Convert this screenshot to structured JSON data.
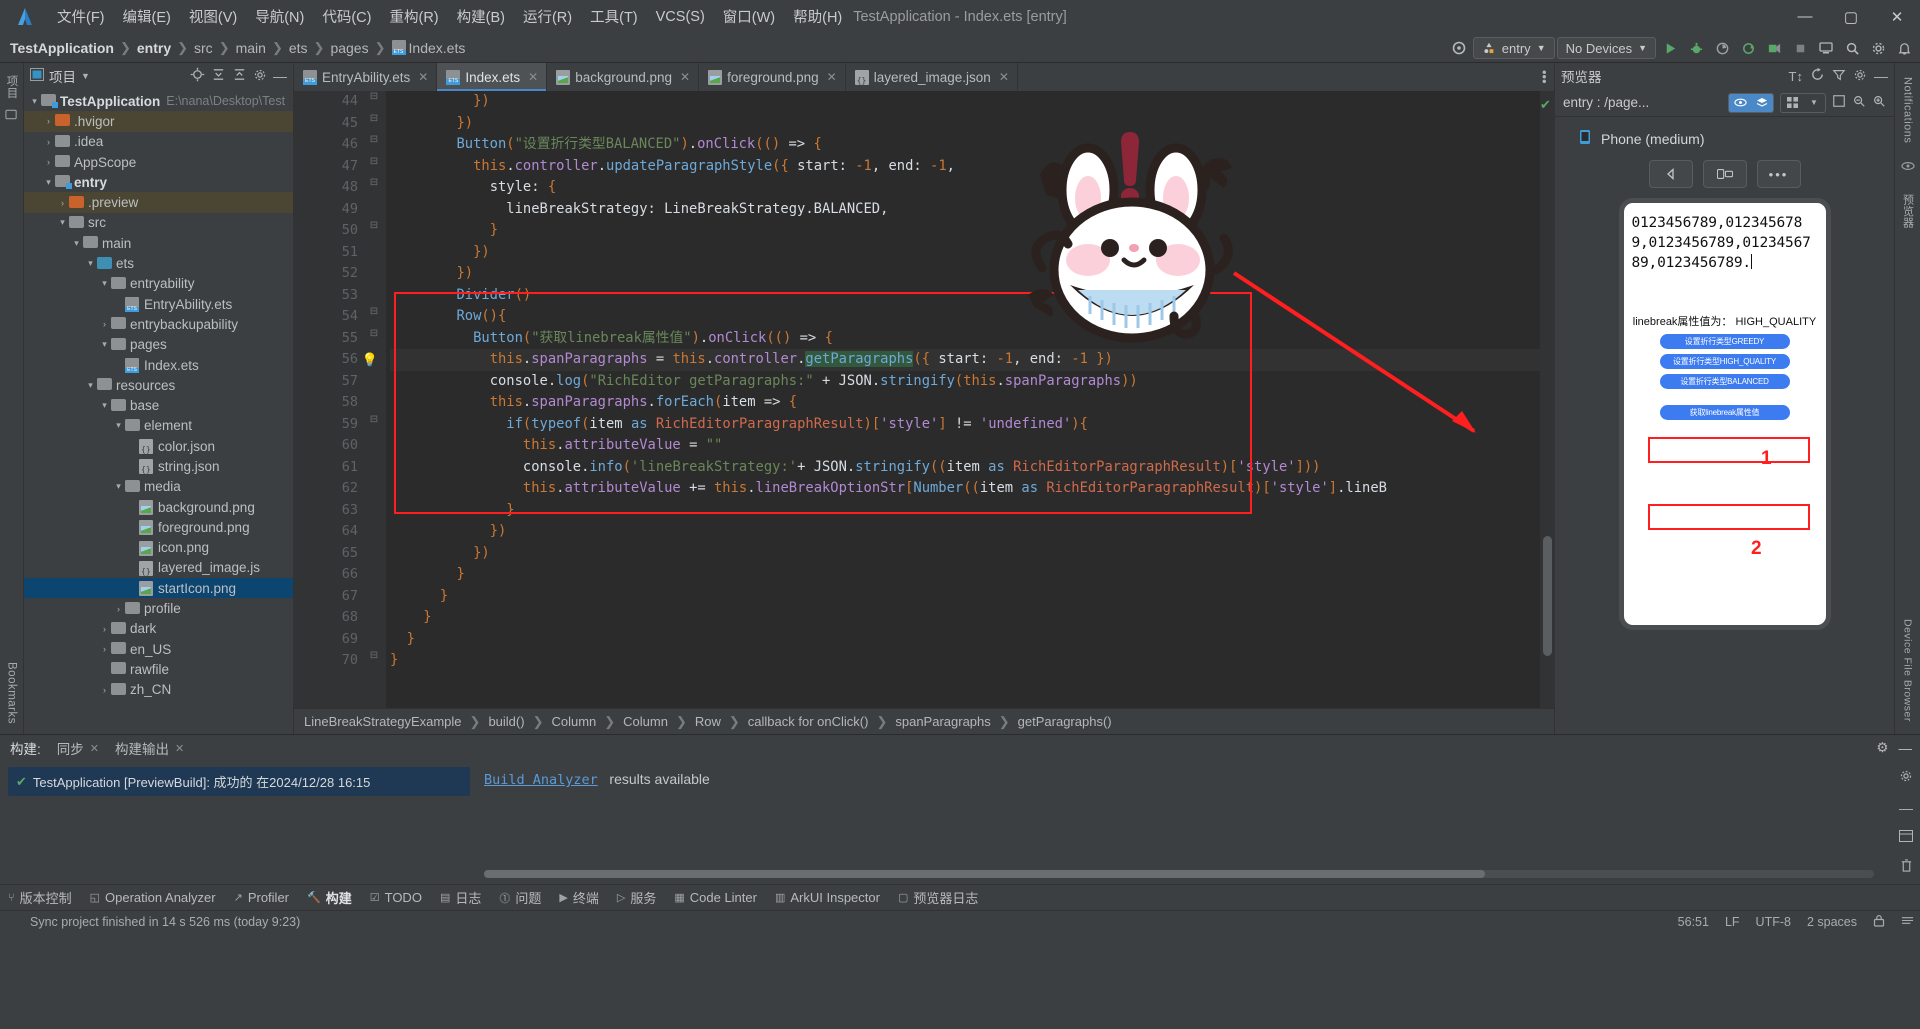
{
  "window": {
    "title": "TestApplication - Index.ets [entry]",
    "minimize": "—",
    "maximize": "▢",
    "close": "✕"
  },
  "menu": [
    "文件(F)",
    "编辑(E)",
    "视图(V)",
    "导航(N)",
    "代码(C)",
    "重构(R)",
    "构建(B)",
    "运行(R)",
    "工具(T)",
    "VCS(S)",
    "窗口(W)",
    "帮助(H)"
  ],
  "breadcrumb": [
    "TestApplication",
    "entry",
    "src",
    "main",
    "ets",
    "pages",
    "Index.ets"
  ],
  "toolbar": {
    "run_config": "entry",
    "device": "No Devices",
    "target_icon": "target-icon",
    "run_icon": "run-icon",
    "debug_icon": "debug-icon",
    "profile_icon": "profile-icon",
    "sync_icon": "sync-icon",
    "attach_icon": "attach-icon",
    "stop_icon": "stop-icon",
    "device_manager_icon": "device-manager-icon",
    "search_icon": "search-icon",
    "settings_icon": "gear-icon",
    "notifications_icon": "bell-icon"
  },
  "project_panel": {
    "title": "项目",
    "dropdown_icon": "chevron-down-icon",
    "locate_icon": "locate-icon",
    "expand_icon": "expand-all-icon",
    "collapse_icon": "collapse-all-icon",
    "settings_icon": "gear-icon",
    "hide_icon": "hide-icon",
    "tree": [
      {
        "depth": 0,
        "arrow": "▾",
        "icon": "module-folder",
        "name": "TestApplication",
        "bold": true,
        "path": "E:\\nana\\Desktop\\Test",
        "state": "normal"
      },
      {
        "depth": 1,
        "arrow": "›",
        "icon": "orange-folder",
        "name": ".hvigor",
        "state": "highlight"
      },
      {
        "depth": 1,
        "arrow": "›",
        "icon": "folder",
        "name": ".idea",
        "state": "normal"
      },
      {
        "depth": 1,
        "arrow": "›",
        "icon": "folder",
        "name": "AppScope",
        "state": "normal"
      },
      {
        "depth": 1,
        "arrow": "▾",
        "icon": "module-folder",
        "name": "entry",
        "bold": true,
        "state": "normal"
      },
      {
        "depth": 2,
        "arrow": "›",
        "icon": "orange-folder",
        "name": ".preview",
        "state": "highlight"
      },
      {
        "depth": 2,
        "arrow": "▾",
        "icon": "folder",
        "name": "src",
        "state": "normal"
      },
      {
        "depth": 3,
        "arrow": "▾",
        "icon": "folder",
        "name": "main",
        "state": "normal"
      },
      {
        "depth": 4,
        "arrow": "▾",
        "icon": "blue-folder",
        "name": "ets",
        "state": "normal"
      },
      {
        "depth": 5,
        "arrow": "▾",
        "icon": "folder",
        "name": "entryability",
        "state": "normal"
      },
      {
        "depth": 6,
        "arrow": "",
        "icon": "ets-file",
        "name": "EntryAbility.ets",
        "state": "normal"
      },
      {
        "depth": 5,
        "arrow": "›",
        "icon": "folder",
        "name": "entrybackupability",
        "state": "normal"
      },
      {
        "depth": 5,
        "arrow": "▾",
        "icon": "folder",
        "name": "pages",
        "state": "normal"
      },
      {
        "depth": 6,
        "arrow": "",
        "icon": "ets-file",
        "name": "Index.ets",
        "state": "normal"
      },
      {
        "depth": 4,
        "arrow": "▾",
        "icon": "folder",
        "name": "resources",
        "state": "normal"
      },
      {
        "depth": 5,
        "arrow": "▾",
        "icon": "folder",
        "name": "base",
        "state": "normal"
      },
      {
        "depth": 6,
        "arrow": "▾",
        "icon": "folder",
        "name": "element",
        "state": "normal"
      },
      {
        "depth": 7,
        "arrow": "",
        "icon": "json-file",
        "name": "color.json",
        "state": "normal"
      },
      {
        "depth": 7,
        "arrow": "",
        "icon": "json-file",
        "name": "string.json",
        "state": "normal"
      },
      {
        "depth": 6,
        "arrow": "▾",
        "icon": "folder",
        "name": "media",
        "state": "normal"
      },
      {
        "depth": 7,
        "arrow": "",
        "icon": "png-file",
        "name": "background.png",
        "state": "normal"
      },
      {
        "depth": 7,
        "arrow": "",
        "icon": "png-file",
        "name": "foreground.png",
        "state": "normal"
      },
      {
        "depth": 7,
        "arrow": "",
        "icon": "png-file",
        "name": "icon.png",
        "state": "normal"
      },
      {
        "depth": 7,
        "arrow": "",
        "icon": "json-file",
        "name": "layered_image.js",
        "state": "normal"
      },
      {
        "depth": 7,
        "arrow": "",
        "icon": "png-file",
        "name": "startIcon.png",
        "state": "selected"
      },
      {
        "depth": 6,
        "arrow": "›",
        "icon": "folder",
        "name": "profile",
        "state": "normal"
      },
      {
        "depth": 5,
        "arrow": "›",
        "icon": "folder",
        "name": "dark",
        "state": "normal"
      },
      {
        "depth": 5,
        "arrow": "›",
        "icon": "folder",
        "name": "en_US",
        "state": "normal"
      },
      {
        "depth": 5,
        "arrow": "",
        "icon": "folder",
        "name": "rawfile",
        "state": "normal"
      },
      {
        "depth": 5,
        "arrow": "›",
        "icon": "folder",
        "name": "zh_CN",
        "state": "normal"
      }
    ]
  },
  "left_strip": {
    "project_label": "项目",
    "structure_icon": "structure-icon",
    "bookmarks_label": "Bookmarks"
  },
  "right_strip": {
    "notifications_label": "Notifications",
    "preview_label": "预览器",
    "device_file_label": "Device File Browser"
  },
  "editor": {
    "tabs": [
      {
        "label": "EntryAbility.ets",
        "icon": "ets-file",
        "active": false
      },
      {
        "label": "Index.ets",
        "icon": "ets-file",
        "active": true
      },
      {
        "label": "background.png",
        "icon": "png-file",
        "active": false
      },
      {
        "label": "foreground.png",
        "icon": "png-file",
        "active": false
      },
      {
        "label": "layered_image.json",
        "icon": "json-file",
        "active": false
      }
    ],
    "more_icon": "more-vertical-icon",
    "first_line": 44,
    "lines": [
      {
        "n": 44,
        "fold": "⌐",
        "html": "          <span class='or'>})</span>"
      },
      {
        "n": 45,
        "fold": "⌐",
        "html": "        <span class='or'>})</span>"
      },
      {
        "n": 46,
        "fold": "⌐",
        "html": "        <span class='bl'>Button</span><span class='or'>(</span><span class='gr'>\"设置折行类型BALANCED\"</span><span class='or'>)</span><span class='wh'>.</span><span class='pp'>onClick</span><span class='or'>((</span><span class='or'>)</span> <span class='wh'>=&gt;</span> <span class='or'>{</span>"
      },
      {
        "n": 47,
        "fold": "⌐",
        "html": "          <span class='or'>this</span><span class='wh'>.</span><span class='pp'>controller</span><span class='wh'>.</span><span class='bl'>updateParagraphStyle</span><span class='or'>({</span> <span class='wh'>start:</span> <span class='or'>-1</span><span class='wh'>, end:</span> <span class='or'>-1</span><span class='wh'>,</span>"
      },
      {
        "n": 48,
        "fold": "⌐",
        "html": "            <span class='wh'>style:</span> <span class='or'>{</span>"
      },
      {
        "n": 49,
        "fold": "",
        "html": "              <span class='wh'>lineBreakStrategy: LineBreakStrategy.BALANCED,</span>"
      },
      {
        "n": 50,
        "fold": "⌐",
        "html": "            <span class='or'>}</span>"
      },
      {
        "n": 51,
        "fold": "",
        "html": "          <span class='or'>})</span>"
      },
      {
        "n": 52,
        "fold": "",
        "html": "        <span class='or'>})</span>"
      },
      {
        "n": 53,
        "fold": "",
        "html": "        <span class='bl'>Divider</span><span class='or'>()</span>"
      },
      {
        "n": 54,
        "fold": "⌐",
        "html": "        <span class='bl'>Row</span><span class='or'>(){</span>"
      },
      {
        "n": 55,
        "fold": "⌐",
        "html": "          <span class='bl'>Button</span><span class='or'>(</span><span class='gr'>\"获取linebreak属性值\"</span><span class='or'>)</span><span class='wh'>.</span><span class='pp'>onClick</span><span class='or'>((</span><span class='or'>)</span> <span class='wh'>=&gt;</span> <span class='or'>{</span>"
      },
      {
        "n": 56,
        "fold": "",
        "bulb": true,
        "cur": true,
        "html": "            <span class='or'>this</span><span class='wh'>.</span><span class='pp'>spanParagraphs</span> <span class='wh'>=</span> <span class='or'>this</span><span class='wh'>.</span><span class='pp'>controller</span><span class='wh'>.</span><span class='hlx bl'>getParagraphs</span><span class='or'>({</span> <span class='wh'>start:</span> <span class='or'>-1</span><span class='wh'>, end:</span> <span class='or'>-1</span> <span class='or'>})</span>"
      },
      {
        "n": 57,
        "fold": "",
        "html": "            <span class='wh'>console</span><span class='wh'>.</span><span class='bl'>log</span><span class='or'>(</span><span class='gr'>\"RichEditor getParagraphs:\"</span> <span class='wh'>+</span> <span class='wh'>JSON</span><span class='wh'>.</span><span class='bl'>stringify</span><span class='or'>(</span><span class='or'>this</span><span class='wh'>.</span><span class='pp'>spanParagraphs</span><span class='or'>))</span>"
      },
      {
        "n": 58,
        "fold": "",
        "html": "            <span class='or'>this</span><span class='wh'>.</span><span class='pp'>spanParagraphs</span><span class='wh'>.</span><span class='bl'>forEach</span><span class='or'>(</span><span class='wh'>item</span> <span class='wh'>=&gt;</span> <span class='or'>{</span>"
      },
      {
        "n": 59,
        "fold": "⌐",
        "html": "              <span class='bl'>if</span><span class='or'>(</span><span class='bl'>typeof</span><span class='or'>(</span><span class='wh'>item</span> <span class='bl'>as</span> <span class='red'>RichEditorParagraphResult</span><span class='or'>)[</span><span class='pp'>'style'</span><span class='or'>]</span> <span class='wh'>!=</span> <span class='pp'>'undefined'</span><span class='or'>){</span>"
      },
      {
        "n": 60,
        "fold": "",
        "html": "                <span class='or'>this</span><span class='wh'>.</span><span class='pp'>attributeValue</span> <span class='wh'>=</span> <span class='gr'>\"\"</span>"
      },
      {
        "n": 61,
        "fold": "",
        "html": "                <span class='wh'>console</span><span class='wh'>.</span><span class='bl'>info</span><span class='or'>(</span><span class='gr'>'lineBreakStrategy:'</span><span class='wh'>+</span> <span class='wh'>JSON</span><span class='wh'>.</span><span class='bl'>stringify</span><span class='or'>((</span><span class='wh'>item</span> <span class='bl'>as</span> <span class='red'>RichEditorParagraphResult</span><span class='or'>)[</span><span class='pp'>'style'</span><span class='or'>]))</span>"
      },
      {
        "n": 62,
        "fold": "",
        "html": "                <span class='or'>this</span><span class='wh'>.</span><span class='pp'>attributeValue</span> <span class='wh'>+=</span> <span class='or'>this</span><span class='wh'>.</span><span class='pp'>lineBreakOptionStr</span><span class='or'>[</span><span class='bl'>Number</span><span class='or'>((</span><span class='wh'>item</span> <span class='bl'>as</span> <span class='red'>RichEditorParagraphResult</span><span class='or'>)[</span><span class='pp'>'style'</span><span class='or'>]</span><span class='wh'>.lineB</span>"
      },
      {
        "n": 63,
        "fold": "",
        "html": "              <span class='or'>}</span>"
      },
      {
        "n": 64,
        "fold": "",
        "html": "            <span class='or'>})</span>"
      },
      {
        "n": 65,
        "fold": "",
        "html": "          <span class='or'>})</span>"
      },
      {
        "n": 66,
        "fold": "",
        "html": "        <span class='or'>}</span>"
      },
      {
        "n": 67,
        "fold": "",
        "html": "      <span class='or'>}</span>"
      },
      {
        "n": 68,
        "fold": "",
        "html": "    <span class='or'>}</span>"
      },
      {
        "n": 69,
        "fold": "",
        "html": "  <span class='or'>}</span>"
      },
      {
        "n": 70,
        "fold": "⌐",
        "html": "<span class='or'>}</span>"
      }
    ],
    "status_breadcrumb": [
      "LineBreakStrategyExample",
      "build()",
      "Column",
      "Column",
      "Row",
      "callback for onClick()",
      "spanParagraphs",
      "getParagraphs()"
    ],
    "check_icon": "checkmark-icon"
  },
  "preview": {
    "title": "预览器",
    "font_icon": "font-size-icon",
    "refresh_icon": "refresh-icon",
    "filter_icon": "filter-icon",
    "settings_icon": "gear-icon",
    "hide_icon": "hide-icon",
    "page_name": "entry : /page...",
    "eye_icon": "eye-icon",
    "layers_icon": "layers-icon",
    "grid_icon": "grid-icon",
    "chevron_icon": "chevron-down-icon",
    "frame_icon": "frame-icon",
    "zoom_out_icon": "zoom-out-icon",
    "zoom_in_icon": "zoom-in-icon",
    "device_name": "Phone (medium)",
    "device_icon": "phone-icon",
    "ctrl_back_icon": "back-triangle-icon",
    "ctrl_rotate_icon": "rotate-icon",
    "ctrl_more_icon": "more-icon",
    "phone_text": "0123456789,0123456789,0123456789,0123456789,0123456789.",
    "attr_label": "linebreak属性值为：  HIGH_QUALITY",
    "buttons": [
      {
        "label": "设置折行类型GREEDY",
        "boxed": false
      },
      {
        "label": "设置折行类型HIGH_QUALITY",
        "boxed": true
      },
      {
        "label": "设置折行类型BALANCED",
        "boxed": false
      },
      {
        "label": "获取linebreak属性值",
        "boxed": true
      }
    ],
    "marker_1": "1",
    "marker_2": "2"
  },
  "build_panel": {
    "tabs": [
      {
        "label": "构建:",
        "active": true,
        "closable": false
      },
      {
        "label": "同步",
        "active": false,
        "closable": true
      },
      {
        "label": "构建输出",
        "active": false,
        "closable": true
      }
    ],
    "settings_icon": "gear-icon",
    "hide_icon": "hide-icon",
    "message_icon": "success-check-icon",
    "message": "TestApplication [PreviewBuild]: 成功的 在2024/12/28 16:15",
    "analyzer_link": "Build Analyzer",
    "analyzer_rest": "results available",
    "expand_icon": "expand-icon",
    "chevron_icon": "chevron-right-icon",
    "layout_icon": "layout-icon",
    "settings2_icon": "gear-icon"
  },
  "tool_windows": [
    {
      "label": "版本控制",
      "icon": "vcs-icon",
      "active": false
    },
    {
      "label": "Operation Analyzer",
      "icon": "analyzer-icon",
      "active": false
    },
    {
      "label": "Profiler",
      "icon": "profiler-icon",
      "active": false
    },
    {
      "label": "构建",
      "icon": "build-hammer-icon",
      "active": true
    },
    {
      "label": "TODO",
      "icon": "todo-icon",
      "active": false
    },
    {
      "label": "日志",
      "icon": "log-icon",
      "active": false
    },
    {
      "label": "问题",
      "icon": "problems-icon",
      "active": false
    },
    {
      "label": "终端",
      "icon": "terminal-icon",
      "active": false
    },
    {
      "label": "服务",
      "icon": "services-icon",
      "active": false
    },
    {
      "label": "Code Linter",
      "icon": "linter-icon",
      "active": false
    },
    {
      "label": "ArkUI Inspector",
      "icon": "inspector-icon",
      "active": false
    },
    {
      "label": "预览器日志",
      "icon": "preview-log-icon",
      "active": false
    }
  ],
  "status_bar": {
    "message": "Sync project finished in 14 s 526 ms (today 9:23)",
    "caret": "56:51",
    "line_sep": "LF",
    "encoding": "UTF-8",
    "indent": "2 spaces",
    "lock_icon": "lock-icon",
    "event_icon": "event-log-icon"
  }
}
